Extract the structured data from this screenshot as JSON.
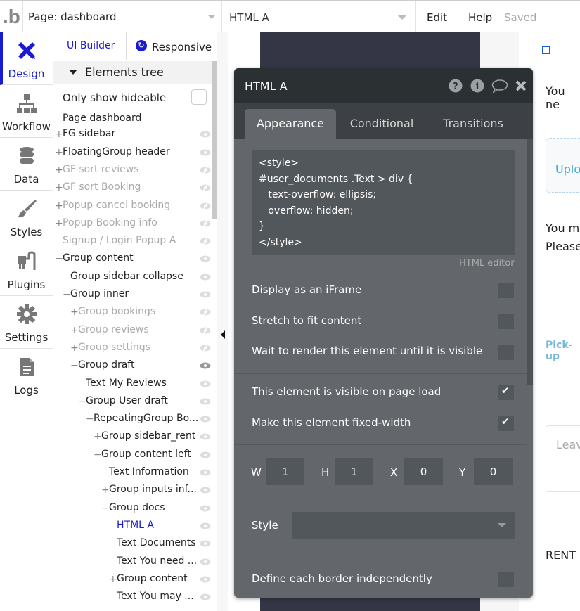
{
  "topbar": {
    "logo": ".b",
    "page_selector": "Page: dashboard",
    "element_selector": "HTML A",
    "menu": [
      "Edit",
      "Help"
    ],
    "status": "Saved"
  },
  "leftnav": [
    {
      "label": "Design",
      "icon": "design-icon",
      "active": true
    },
    {
      "label": "Workflow",
      "icon": "workflow-icon"
    },
    {
      "label": "Data",
      "icon": "database-icon"
    },
    {
      "label": "Styles",
      "icon": "brush-icon"
    },
    {
      "label": "Plugins",
      "icon": "plug-icon"
    },
    {
      "label": "Settings",
      "icon": "gear-icon"
    },
    {
      "label": "Logs",
      "icon": "document-icon"
    }
  ],
  "panel": {
    "tabs": {
      "ui_builder": "UI Builder",
      "responsive": "Responsive"
    },
    "tree_header": "Elements tree",
    "only_hideable": "Only show hideable",
    "tree": [
      {
        "label": "Page dashboard",
        "toggle": "",
        "state": "normal",
        "eye": ""
      },
      {
        "label": "FG sidebar",
        "toggle": "+",
        "state": "normal",
        "eye": "visible"
      },
      {
        "label": "FloatingGroup header",
        "toggle": "+",
        "state": "normal",
        "eye": "visible"
      },
      {
        "label": "GF sort reviews",
        "toggle": "+",
        "state": "hidden",
        "eye": "hidden"
      },
      {
        "label": "GF sort Booking",
        "toggle": "+",
        "state": "hidden",
        "eye": "hidden"
      },
      {
        "label": "Popup cancel booking",
        "toggle": "+",
        "state": "hidden",
        "eye": "hidden"
      },
      {
        "label": "Popup Booking info",
        "toggle": "+",
        "state": "hidden",
        "eye": "hidden"
      },
      {
        "label": "Signup / Login Popup A",
        "toggle": "",
        "state": "hidden",
        "eye": "hidden"
      },
      {
        "label": "Group content",
        "toggle": "−",
        "state": "normal",
        "eye": "visible"
      },
      {
        "label": "Group sidebar collapse",
        "toggle": "",
        "state": "normal",
        "eye": "visible"
      },
      {
        "label": "Group inner",
        "toggle": "−",
        "state": "normal",
        "eye": "visible"
      },
      {
        "label": "Group bookings",
        "toggle": "+",
        "state": "hidden",
        "eye": "hidden"
      },
      {
        "label": "Group reviews",
        "toggle": "+",
        "state": "hidden",
        "eye": "hidden"
      },
      {
        "label": "Group settings",
        "toggle": "+",
        "state": "hidden",
        "eye": "hidden"
      },
      {
        "label": "Group draft",
        "toggle": "−",
        "state": "normal",
        "eye": "visible-dark"
      },
      {
        "label": "Text My Reviews",
        "toggle": "",
        "state": "normal",
        "eye": "visible"
      },
      {
        "label": "Group User draft",
        "toggle": "−",
        "state": "normal",
        "eye": "visible"
      },
      {
        "label": "RepeatingGroup Bo...",
        "toggle": "−",
        "state": "normal",
        "eye": "visible"
      },
      {
        "label": "Group sidebar_rent",
        "toggle": "+",
        "state": "normal",
        "eye": "visible"
      },
      {
        "label": "Group content left",
        "toggle": "−",
        "state": "normal",
        "eye": "visible"
      },
      {
        "label": "Text Information",
        "toggle": "",
        "state": "normal",
        "eye": "visible"
      },
      {
        "label": "Group inputs inf...",
        "toggle": "+",
        "state": "normal",
        "eye": "visible"
      },
      {
        "label": "Group docs",
        "toggle": "−",
        "state": "normal",
        "eye": "visible"
      },
      {
        "label": "HTML A",
        "toggle": "",
        "state": "selected",
        "eye": "visible"
      },
      {
        "label": "Text Documents",
        "toggle": "",
        "state": "normal",
        "eye": "visible"
      },
      {
        "label": "Text You need ...",
        "toggle": "",
        "state": "normal",
        "eye": "visible"
      },
      {
        "label": "Group content",
        "toggle": "+",
        "state": "normal",
        "eye": "visible"
      },
      {
        "label": "Text You may ...",
        "toggle": "",
        "state": "normal",
        "eye": "visible"
      }
    ]
  },
  "editor": {
    "title": "HTML A",
    "header_icons": [
      "help-icon",
      "info-icon",
      "comment-icon",
      "close-icon"
    ],
    "tabs": [
      "Appearance",
      "Conditional",
      "Transitions"
    ],
    "active_tab": "Appearance",
    "code": "<style>\n#user_documents .Text > div {\n   text-overflow: ellipsis;\n   overflow: hidden;\n}\n</style>",
    "code_label": "HTML editor",
    "options": [
      {
        "label": "Display as an iFrame",
        "checked": false
      },
      {
        "label": "Stretch to fit content",
        "checked": false
      },
      {
        "label": "Wait to render this element until it is visible",
        "checked": false
      },
      {
        "label": "This element is visible on page load",
        "checked": true
      },
      {
        "label": "Make this element fixed-width",
        "checked": true
      }
    ],
    "dimensions": {
      "W": "1",
      "H": "1",
      "X": "0",
      "Y": "0"
    },
    "style_label": "Style",
    "style_value": "",
    "border_option": {
      "label": "Define each border independently",
      "checked": false
    }
  },
  "canvas_right": {
    "text1": "You ne",
    "upload": "Uplo",
    "text2_line1": "You m",
    "text2_line2": "Please",
    "pickup": "Pick-up",
    "leave": "Leav",
    "rent": "RENT"
  }
}
